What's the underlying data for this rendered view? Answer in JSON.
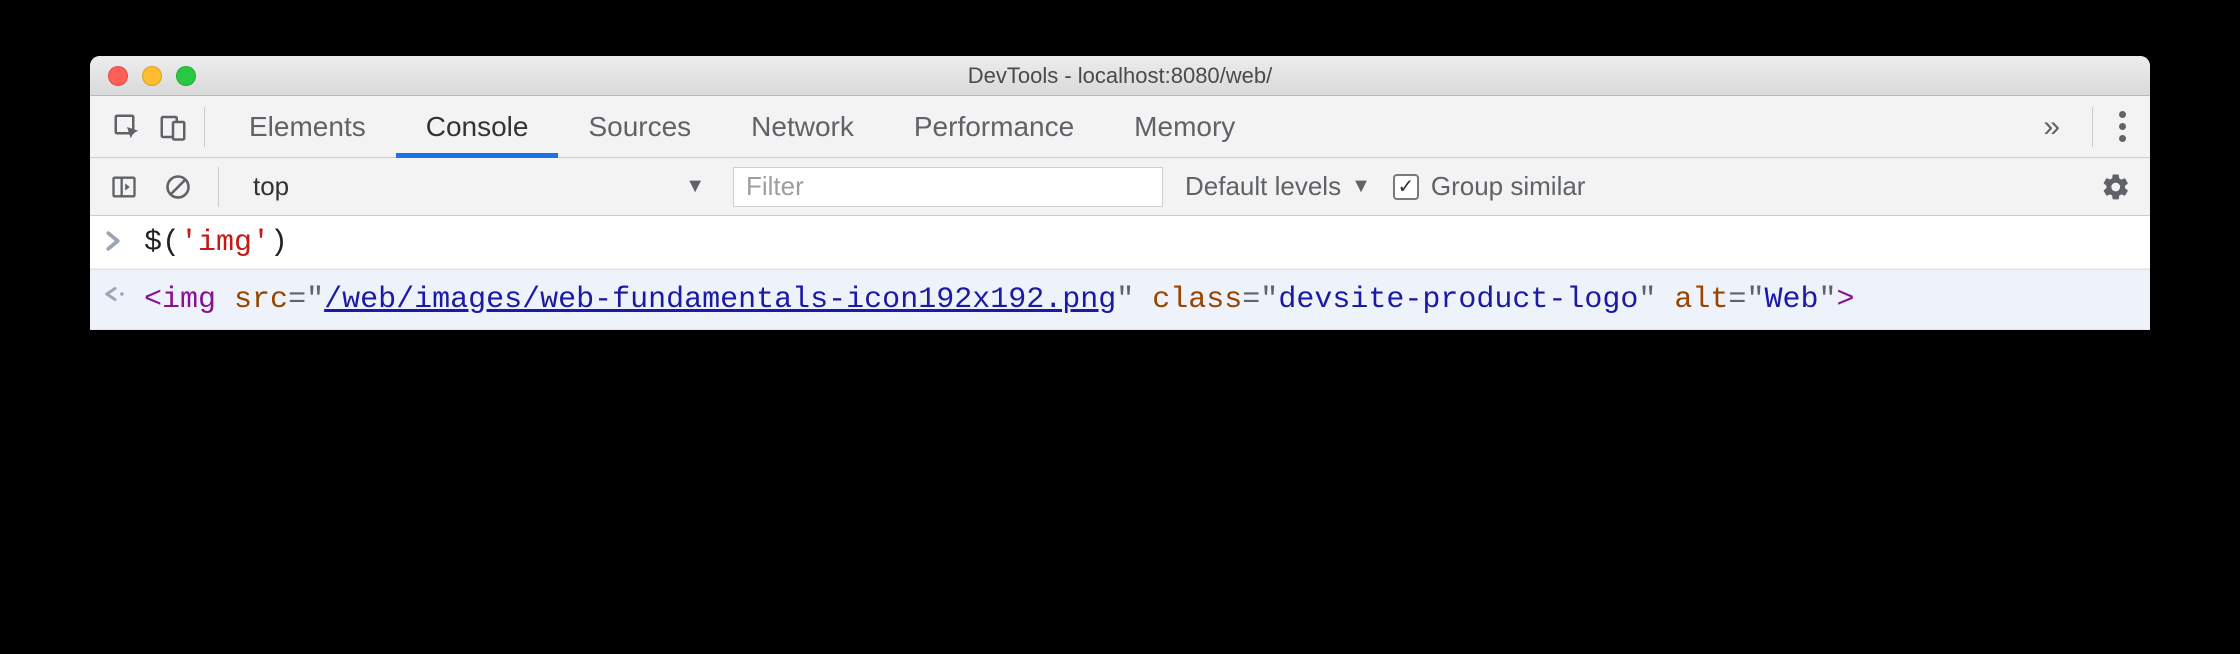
{
  "window": {
    "title": "DevTools - localhost:8080/web/"
  },
  "tabs": {
    "items": [
      "Elements",
      "Console",
      "Sources",
      "Network",
      "Performance",
      "Memory"
    ],
    "active_index": 1
  },
  "toolbar": {
    "context": "top",
    "filter_placeholder": "Filter",
    "levels_label": "Default levels",
    "group_similar_label": "Group similar",
    "group_similar_checked": true
  },
  "console": {
    "input": {
      "fn": "$",
      "open": "(",
      "arg": "'img'",
      "close": ")"
    },
    "result": {
      "open": "<",
      "tag": "img",
      "attrs": [
        {
          "name": "src",
          "value": "/web/images/web-fundamentals-icon192x192.png",
          "link": true
        },
        {
          "name": "class",
          "value": "devsite-product-logo",
          "link": false
        },
        {
          "name": "alt",
          "value": "Web",
          "link": false
        }
      ],
      "close": ">"
    }
  }
}
